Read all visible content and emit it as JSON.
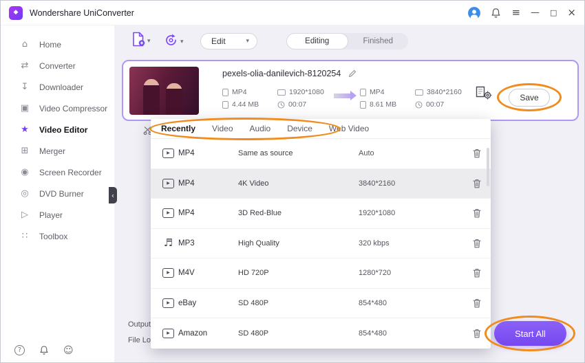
{
  "window": {
    "title": "Wondershare UniConverter"
  },
  "icons": {
    "logo": "◆",
    "home": "⌂",
    "converter": "⇄",
    "downloader": "↧",
    "compressor": "▣",
    "editor": "★",
    "merger": "⊞",
    "recorder": "◉",
    "dvd": "◎",
    "player": "▷",
    "toolbox": "∷",
    "menu": "≡",
    "minimize": "—",
    "maximize": "□",
    "close": "×",
    "chevron_down": "▾",
    "collapse": "‹",
    "play": "▶",
    "music": "♬",
    "help": "?",
    "smiley": "☺"
  },
  "sidebar": {
    "items": [
      {
        "label": "Home"
      },
      {
        "label": "Converter"
      },
      {
        "label": "Downloader"
      },
      {
        "label": "Video Compressor"
      },
      {
        "label": "Video Editor"
      },
      {
        "label": "Merger"
      },
      {
        "label": "Screen Recorder"
      },
      {
        "label": "DVD Burner"
      },
      {
        "label": "Player"
      },
      {
        "label": "Toolbox"
      }
    ]
  },
  "toolbar": {
    "edit_label": "Edit",
    "tabs": [
      {
        "label": "Editing"
      },
      {
        "label": "Finished"
      }
    ]
  },
  "file_card": {
    "title": "pexels-olia-danilevich-8120254",
    "source": {
      "format": "MP4",
      "resolution": "1920*1080",
      "size": "4.44 MB",
      "duration": "00:07"
    },
    "target": {
      "format": "MP4",
      "resolution": "3840*2160",
      "size": "8.61 MB",
      "duration": "00:07"
    },
    "save_label": "Save"
  },
  "format_panel": {
    "tabs": [
      {
        "label": "Recently"
      },
      {
        "label": "Video"
      },
      {
        "label": "Audio"
      },
      {
        "label": "Device"
      },
      {
        "label": "Web Video"
      }
    ],
    "rows": [
      {
        "format": "MP4",
        "description": "Same as source",
        "quality": "Auto"
      },
      {
        "format": "MP4",
        "description": "4K Video",
        "quality": "3840*2160"
      },
      {
        "format": "MP4",
        "description": "3D Red-Blue",
        "quality": "1920*1080"
      },
      {
        "format": "MP3",
        "description": "High Quality",
        "quality": "320 kbps"
      },
      {
        "format": "M4V",
        "description": "HD 720P",
        "quality": "1280*720"
      },
      {
        "format": "eBay",
        "description": "SD 480P",
        "quality": "854*480"
      },
      {
        "format": "Amazon",
        "description": "SD 480P",
        "quality": "854*480"
      }
    ]
  },
  "footer": {
    "output_label": "Output",
    "file_location_label": "File Loc",
    "start_all_label": "Start All"
  },
  "colors": {
    "accent_purple": "#7a4cf0",
    "annotation_orange": "#f08b1e"
  }
}
